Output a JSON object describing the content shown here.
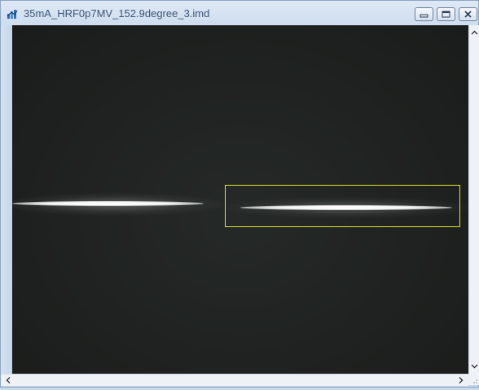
{
  "window": {
    "title": "35mA_HRF0p7MV_152.9degree_3.imd",
    "icon": "app-image-icon",
    "controls": [
      "minimize-icon",
      "restore-icon",
      "close-icon"
    ]
  },
  "colors": {
    "image_background": "#1d201e",
    "stripe": "#ffffff",
    "roi_border": "#e6e62a",
    "titlebar": "#dfe9f5",
    "title_text": "#3b5575"
  },
  "scrollbars": {
    "vertical_icons": [
      "chevron-up-icon",
      "chevron-down-icon"
    ],
    "horizontal_icons": [
      "chevron-left-icon",
      "chevron-right-icon"
    ]
  }
}
